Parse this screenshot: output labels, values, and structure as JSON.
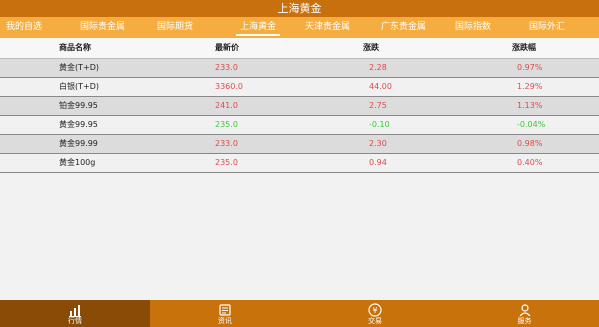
{
  "title": "上海黄金",
  "tabs": [
    {
      "label": "我的自选"
    },
    {
      "label": "国际贵金属"
    },
    {
      "label": "国际期货"
    },
    {
      "label": "上海黄金"
    },
    {
      "label": "天津贵金属"
    },
    {
      "label": "广东贵金属"
    },
    {
      "label": "国际指数"
    },
    {
      "label": "国际外汇"
    }
  ],
  "table": {
    "headers": {
      "name": "商品名称",
      "price": "最新价",
      "change": "涨跌",
      "pct": "涨跌幅"
    },
    "rows": [
      {
        "name": "黄金(T+D)",
        "price": "233.0",
        "change": "2.28",
        "pct": "0.97%",
        "trend": "up"
      },
      {
        "name": "白银(T+D)",
        "price": "3360.0",
        "change": "44.00",
        "pct": "1.29%",
        "trend": "up"
      },
      {
        "name": "铂金99.95",
        "price": "241.0",
        "change": "2.75",
        "pct": "1.13%",
        "trend": "up"
      },
      {
        "name": "黄金99.95",
        "price": "235.0",
        "change": "-0.10",
        "pct": "-0.04%",
        "trend": "down"
      },
      {
        "name": "黄金99.99",
        "price": "233.0",
        "change": "2.30",
        "pct": "0.98%",
        "trend": "up"
      },
      {
        "name": "黄金100g",
        "price": "235.0",
        "change": "0.94",
        "pct": "0.40%",
        "trend": "up"
      }
    ]
  },
  "bottom_nav": [
    {
      "label": "行情",
      "icon": "chart-icon",
      "active": true
    },
    {
      "label": "资讯",
      "icon": "news-icon",
      "active": false
    },
    {
      "label": "交易",
      "icon": "yen-icon",
      "active": false
    },
    {
      "label": "服务",
      "icon": "service-icon",
      "active": false
    }
  ],
  "colors": {
    "up": "#e04a4a",
    "down": "#3cc83c",
    "accent": "#f5ad3f",
    "nav": "#c8720c"
  }
}
